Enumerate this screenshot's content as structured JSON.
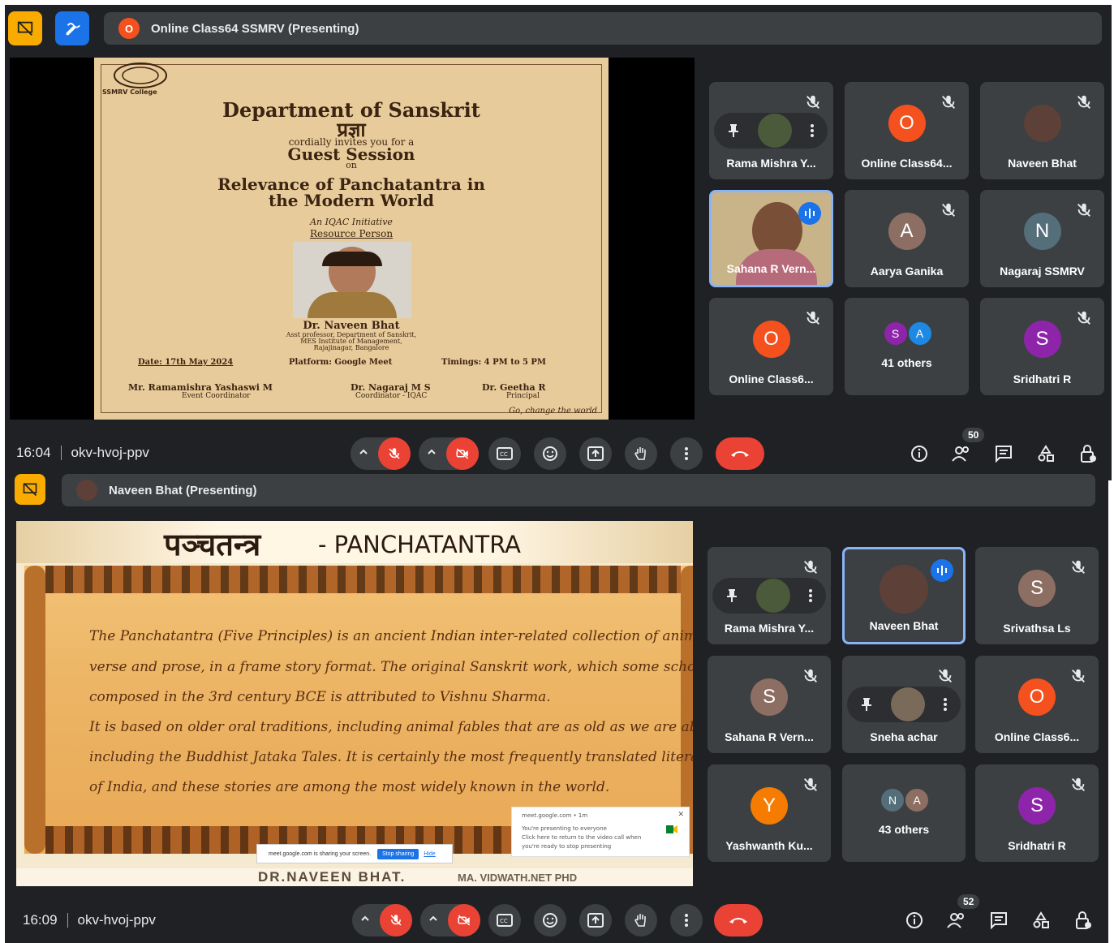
{
  "colors": {
    "bg": "#202124",
    "tile": "#3c4043",
    "accent": "#8ab4f8",
    "end": "#ea4335",
    "present": "#f9ab00"
  },
  "screen1": {
    "presenter_label": "Online Class64 SSMRV (Presenting)",
    "presenter_initial": "O",
    "poster": {
      "college": "SSMRV College",
      "dept": "Department of Sanskrit",
      "prajna": "प्रज्ञा",
      "invite": "cordially invites you for a",
      "session": "Guest Session",
      "on": "on",
      "title1": "Relevance of Panchatantra in",
      "title2": "the Modern World",
      "initiative": "An IQAC Initiative",
      "resource": "Resource Person",
      "speaker": "Dr. Naveen Bhat",
      "speaker_desc1": "Asst professor, Department of Sanskrit,",
      "speaker_desc2": "MES Institute of Management,",
      "speaker_desc3": "Rajajinagar, Bangalore",
      "date": "Date: 17th May 2024",
      "platform": "Platform: Google Meet",
      "timings": "Timings: 4 PM to 5 PM",
      "coord1_name": "Mr. Ramamishra Yashaswi M",
      "coord1_role": "Event Coordinator",
      "coord2_name": "Dr. Nagaraj M S",
      "coord2_role": "Coordinator - IQAC",
      "coord3_name": "Dr. Geetha R",
      "coord3_role": "Principal",
      "motto": "Go, change the world"
    },
    "tiles": [
      {
        "name": "Rama Mishra Y...",
        "type": "hover"
      },
      {
        "name": "Online Class64...",
        "initial": "O",
        "color": "#f4511e"
      },
      {
        "name": "Naveen Bhat",
        "type": "photo"
      },
      {
        "name": "Sahana R Vern...",
        "type": "video"
      },
      {
        "name": "Aarya Ganika",
        "initial": "A",
        "color": "#8d6e63"
      },
      {
        "name": "Nagaraj SSMRV",
        "initial": "N",
        "color": "#546e7a"
      },
      {
        "name": "Online Class6...",
        "initial": "O",
        "color": "#f4511e"
      },
      {
        "name": "41 others",
        "a": "S",
        "b": "A",
        "ca": "#8e24aa",
        "cb": "#1e88e5"
      },
      {
        "name": "Sridhatri R",
        "initial": "S",
        "color": "#8e24aa"
      }
    ],
    "time": "16:04",
    "code": "okv-hvoj-ppv",
    "people_count": "50"
  },
  "screen2": {
    "presenter_label": "Naveen Bhat (Presenting)",
    "slide": {
      "title_hi": "पञ्चतन्त्र",
      "title_en": " - PANCHATANTRA",
      "lines": [
        "The Panchatantra (Five Principles) is an ancient Indian inter-related collection of animal fables in",
        "verse and prose, in a frame story format. The original Sanskrit work, which some scholars believe was",
        "composed in the 3rd century BCE is attributed to Vishnu Sharma.",
        "It is based on older oral traditions, including animal fables that are as old as we are able to imagine,",
        "including the Buddhist Jataka Tales. It is certainly the most frequently translated literary product",
        "of India, and these stories are among the most widely known in the world."
      ],
      "footer_name": "DR.NAVEEN BHAT.",
      "footer_deg": "MA. VIDWATH.NET PHD",
      "share_text": "meet.google.com is sharing your screen.",
      "stop_btn": "Stop sharing",
      "hide": "Hide",
      "notif_src": "meet.google.com • 1m",
      "notif_l1": "You're presenting to everyone",
      "notif_l2": "Click here to return to the video call when",
      "notif_l3": "you're ready to stop presenting"
    },
    "tiles": [
      {
        "name": "Rama Mishra Y...",
        "type": "hover"
      },
      {
        "name": "Naveen Bhat",
        "type": "photo-active"
      },
      {
        "name": "Srivathsa Ls",
        "initial": "S",
        "color": "#8d6e63"
      },
      {
        "name": "Sahana R Vern...",
        "initial": "S",
        "color": "#8d6e63"
      },
      {
        "name": "Sneha achar",
        "type": "hover"
      },
      {
        "name": "Online Class6...",
        "initial": "O",
        "color": "#f4511e"
      },
      {
        "name": "Yashwanth Ku...",
        "initial": "Y",
        "color": "#f57c00"
      },
      {
        "name": "43 others",
        "a": "N",
        "b": "A",
        "ca": "#546e7a",
        "cb": "#8d6e63"
      },
      {
        "name": "Sridhatri R",
        "initial": "S",
        "color": "#8e24aa"
      }
    ],
    "time": "16:09",
    "code": "okv-hvoj-ppv",
    "people_count": "52"
  }
}
